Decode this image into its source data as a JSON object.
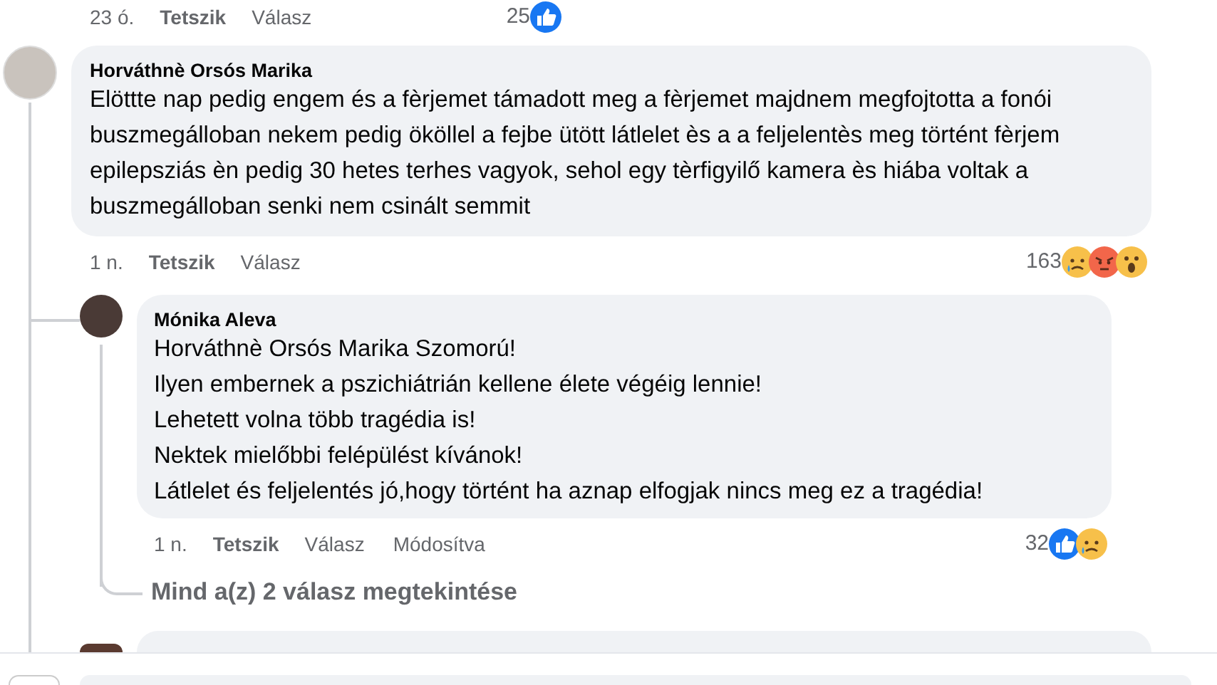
{
  "top_actions": {
    "time": "23 ó.",
    "like": "Tetszik",
    "reply": "Válasz",
    "count": "25",
    "reactions": [
      {
        "kind": "like"
      }
    ]
  },
  "comment": {
    "author": "Horváthnè Orsós Marika",
    "text": "Elöttte nap pedig engem és a fèrjemet támadott meg a fèrjemet majdnem megfojtotta a fonói buszmegálloban nekem pedig ököllel a fejbe ütött látlelet ès a a feljelentès meg történt fèrjem epilepsziás èn pedig 30 hetes terhes vagyok, sehol egy tèrfigyilő kamera ès hiába voltak a buszmegálloban senki nem csinált semmit",
    "time": "1 n.",
    "like": "Tetszik",
    "reply": "Válasz",
    "count": "163",
    "reactions": [
      {
        "kind": "sad"
      },
      {
        "kind": "angry"
      },
      {
        "kind": "wow"
      }
    ]
  },
  "reply": {
    "author": "Mónika Aleva",
    "lines": [
      "Horváthnè Orsós Marika Szomorú!",
      "Ilyen embernek a pszichiátrián kellene élete végéig lennie!",
      "Lehetett volna több tragédia is!",
      "Nektek mielőbbi felépülést kívánok!",
      "Látlelet és feljelentés jó,hogy történt ha aznap elfogjak nincs meg ez a tragédia!"
    ],
    "time": "1 n.",
    "like": "Tetszik",
    "reply": "Válasz",
    "edited": "Módosítva",
    "count": "32",
    "reactions": [
      {
        "kind": "like"
      },
      {
        "kind": "sad"
      }
    ]
  },
  "view_replies": "Mind a(z) 2 válasz megtekintése"
}
